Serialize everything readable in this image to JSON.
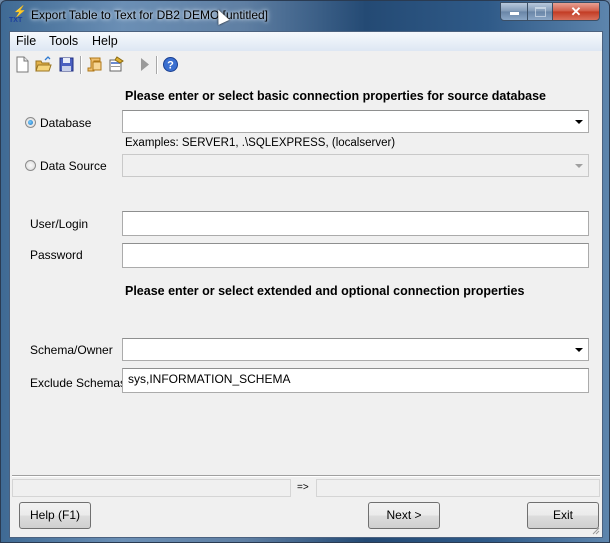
{
  "window": {
    "title": "Export Table to Text for DB2 DEMO [untitled]",
    "app_icon_text": "TXT",
    "controls": {
      "minimize": "minimize",
      "maximize": "maximize",
      "close": "✕"
    }
  },
  "menu": [
    {
      "label": "File"
    },
    {
      "label": "Tools"
    },
    {
      "label": "Help"
    }
  ],
  "toolbar": {
    "buttons": [
      {
        "name": "new-file",
        "icon": "new-document-icon"
      },
      {
        "name": "open",
        "icon": "open-folder-icon"
      },
      {
        "name": "save",
        "icon": "save-disk-icon"
      },
      {
        "name": "script",
        "icon": "script-scroll-icon"
      },
      {
        "name": "properties",
        "icon": "properties-icon"
      },
      {
        "name": "run",
        "icon": "play-icon",
        "disabled": true
      },
      {
        "name": "help",
        "icon": "help-icon"
      }
    ]
  },
  "form": {
    "heading_basic": "Please enter or select basic connection properties for source database",
    "database_label": "Database",
    "database_selected": true,
    "database_value": "",
    "examples_text": "Examples: SERVER1, .\\SQLEXPRESS, (localserver)",
    "datasource_label": "Data Source",
    "datasource_selected": false,
    "datasource_value": "",
    "user_label": "User/Login",
    "user_value": "",
    "password_label": "Password",
    "password_value": "",
    "heading_extended": "Please enter or select extended and optional connection properties",
    "schema_label": "Schema/Owner",
    "schema_value": "",
    "exclude_label": "Exclude Schemas",
    "exclude_value": "sys,INFORMATION_SCHEMA"
  },
  "status": {
    "left": "",
    "arrow": "=>",
    "right": ""
  },
  "buttons": {
    "help": "Help (F1)",
    "next": "Next >",
    "exit": "Exit"
  }
}
